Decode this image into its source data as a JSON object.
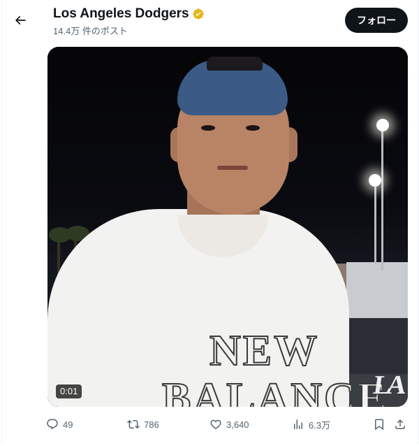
{
  "header": {
    "account_name": "Los Angeles Dodgers",
    "post_count": "14.4万 件のポスト",
    "follow_label": "フォロー"
  },
  "video": {
    "timestamp": "0:01",
    "shirt_line1": "NEW",
    "shirt_line2": "BALANCE",
    "watermark": "LA"
  },
  "actions": {
    "replies": "49",
    "reposts": "786",
    "likes": "3,640",
    "views": "6.3万"
  },
  "icons": [
    "back-arrow-icon",
    "verified-badge-icon",
    "reply-icon",
    "repost-icon",
    "like-icon",
    "views-icon",
    "bookmark-icon",
    "share-icon"
  ],
  "colors": {
    "verified_gold": "#e2b719",
    "follow_bg": "#0f1419",
    "secondary_text": "#536471"
  }
}
